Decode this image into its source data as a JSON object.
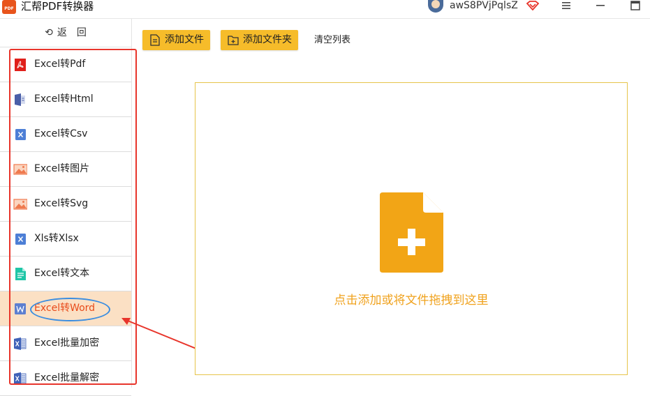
{
  "app": {
    "logo_text": "PDF",
    "title": "汇帮PDF转换器",
    "username": "awS8PVjPqlsZ"
  },
  "sidebar": {
    "back_label": "返　回",
    "items": [
      {
        "label": "Excel转Pdf",
        "icon": "pdf-icon",
        "active": false
      },
      {
        "label": "Excel转Html",
        "icon": "html-file-icon",
        "active": false
      },
      {
        "label": "Excel转Csv",
        "icon": "excel-icon",
        "active": false
      },
      {
        "label": "Excel转图片",
        "icon": "image-icon",
        "active": false
      },
      {
        "label": "Excel转Svg",
        "icon": "image-icon",
        "active": false
      },
      {
        "label": "Xls转Xlsx",
        "icon": "excel-icon",
        "active": false
      },
      {
        "label": "Excel转文本",
        "icon": "text-file-icon",
        "active": false
      },
      {
        "label": "Excel转Word",
        "icon": "word-icon",
        "active": true
      },
      {
        "label": "Excel批量加密",
        "icon": "excel-lock-icon",
        "active": false
      },
      {
        "label": "Excel批量解密",
        "icon": "excel-unlock-icon",
        "active": false
      }
    ]
  },
  "toolbar": {
    "add_file": "添加文件",
    "add_folder": "添加文件夹",
    "clear_list": "清空列表"
  },
  "dropzone": {
    "hint": "点击添加或将文件拖拽到这里"
  },
  "colors": {
    "accent": "#f6bc2a",
    "active_bg": "#fbe0c4",
    "active_text": "#e84a1a",
    "drop_hint": "#f0a21d",
    "annotation_red": "#e8352b",
    "annotation_blue": "#3a8de0"
  }
}
